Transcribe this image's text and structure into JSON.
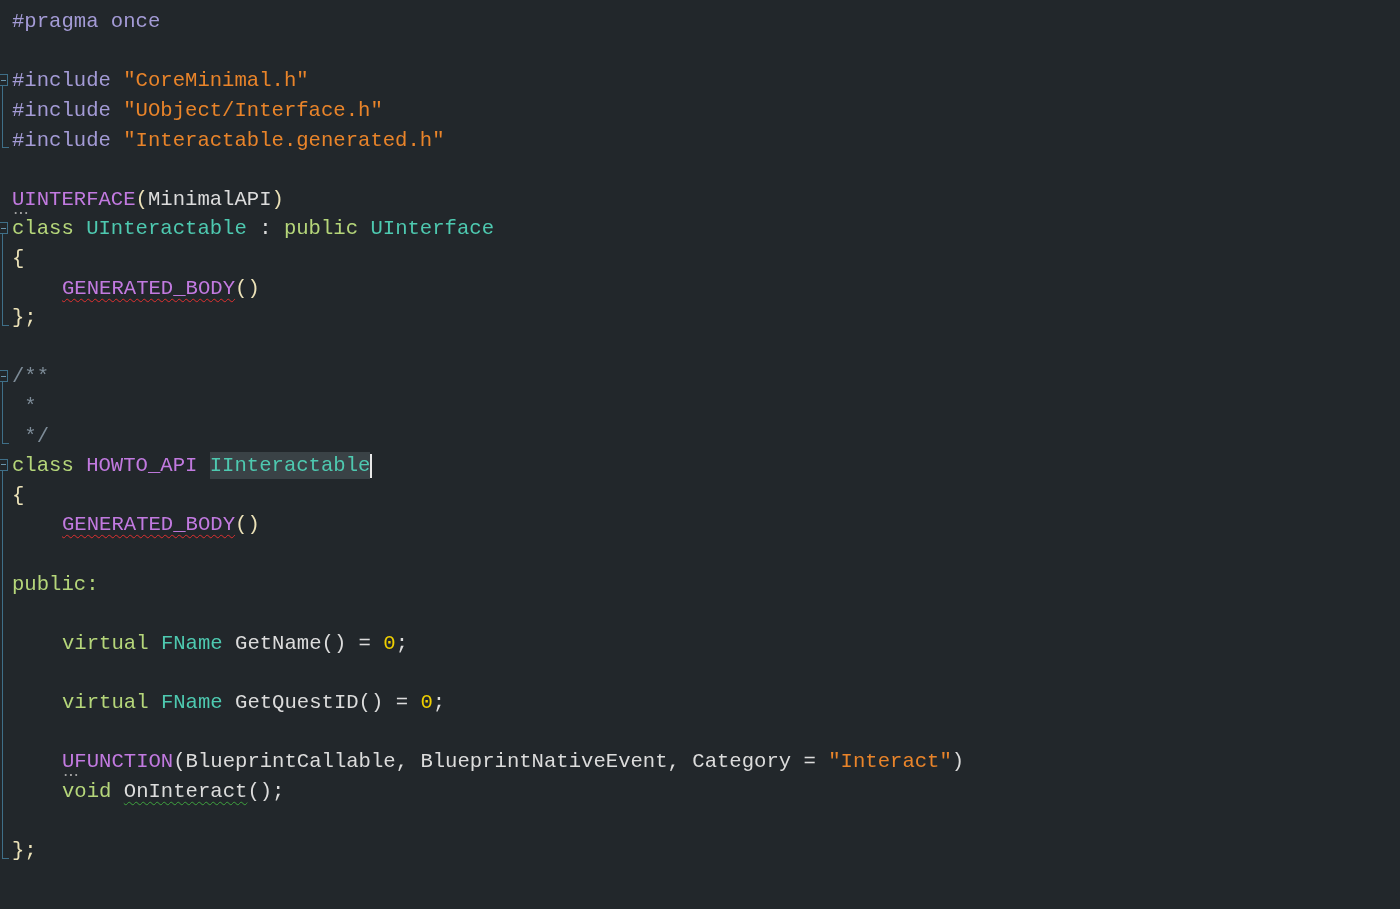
{
  "editor": {
    "lines": [
      {
        "tokens": [
          {
            "kind": "preproc",
            "text": "#pragma once"
          }
        ]
      },
      {
        "in_fold": false
      },
      {
        "fold_start": true,
        "tokens": [
          {
            "kind": "preproc",
            "text": "#include "
          },
          {
            "kind": "string",
            "text": "\"CoreMinimal.h\""
          }
        ]
      },
      {
        "in_fold": true,
        "tokens": [
          {
            "kind": "preproc",
            "text": "#include "
          },
          {
            "kind": "string",
            "text": "\"UObject/Interface.h\""
          }
        ]
      },
      {
        "fold_end": true,
        "tokens": [
          {
            "kind": "preproc",
            "text": "#include "
          },
          {
            "kind": "string",
            "text": "\"Interactable.generated.h\""
          }
        ]
      },
      {
        "in_fold": false
      },
      {
        "tokens": [
          {
            "kind": "macro",
            "text": "UINTERFACE",
            "hint": true
          },
          {
            "kind": "punct",
            "text": "("
          },
          {
            "kind": "plain",
            "text": "MinimalAPI"
          },
          {
            "kind": "punct",
            "text": ")"
          }
        ]
      },
      {
        "fold_start": true,
        "tokens": [
          {
            "kind": "keyword",
            "text": "class "
          },
          {
            "kind": "type",
            "text": "UInteractable"
          },
          {
            "kind": "plain",
            "text": " : "
          },
          {
            "kind": "keyword",
            "text": "public "
          },
          {
            "kind": "type",
            "text": "UInterface"
          }
        ]
      },
      {
        "in_fold": true,
        "tokens": [
          {
            "kind": "punct",
            "text": "{"
          }
        ]
      },
      {
        "in_fold": true,
        "indent": true,
        "tokens": [
          {
            "kind": "macro",
            "text": "GENERATED_BODY",
            "error": true
          },
          {
            "kind": "punct",
            "text": "()"
          }
        ]
      },
      {
        "fold_end": true,
        "tokens": [
          {
            "kind": "punct",
            "text": "};"
          }
        ]
      },
      {
        "in_fold": false
      },
      {
        "fold_start": true,
        "tokens": [
          {
            "kind": "comment",
            "text": "/**"
          }
        ]
      },
      {
        "in_fold": true,
        "tokens": [
          {
            "kind": "comment",
            "text": " *"
          }
        ]
      },
      {
        "fold_end": true,
        "tokens": [
          {
            "kind": "comment",
            "text": " */"
          }
        ]
      },
      {
        "fold_start": true,
        "tokens": [
          {
            "kind": "keyword",
            "text": "class "
          },
          {
            "kind": "macro",
            "text": "HOWTO_API "
          },
          {
            "kind": "type",
            "text": "IInteractable",
            "highlighted": true,
            "caret": true
          }
        ]
      },
      {
        "in_fold": true,
        "tokens": [
          {
            "kind": "punct",
            "text": "{"
          }
        ]
      },
      {
        "in_fold": true,
        "indent": true,
        "tokens": [
          {
            "kind": "macro",
            "text": "GENERATED_BODY",
            "error": true
          },
          {
            "kind": "punct",
            "text": "()"
          }
        ]
      },
      {
        "in_fold": true
      },
      {
        "in_fold": true,
        "tokens": [
          {
            "kind": "keyword",
            "text": "public:"
          }
        ]
      },
      {
        "in_fold": true
      },
      {
        "in_fold": true,
        "indent": true,
        "tokens": [
          {
            "kind": "keyword",
            "text": "virtual "
          },
          {
            "kind": "type",
            "text": "FName"
          },
          {
            "kind": "plain",
            "text": " GetName() = "
          },
          {
            "kind": "number",
            "text": "0"
          },
          {
            "kind": "plain",
            "text": ";"
          }
        ]
      },
      {
        "in_fold": true
      },
      {
        "in_fold": true,
        "indent": true,
        "tokens": [
          {
            "kind": "keyword",
            "text": "virtual "
          },
          {
            "kind": "type",
            "text": "FName"
          },
          {
            "kind": "plain",
            "text": " GetQuestID() = "
          },
          {
            "kind": "number",
            "text": "0"
          },
          {
            "kind": "plain",
            "text": ";"
          }
        ]
      },
      {
        "in_fold": true
      },
      {
        "in_fold": true,
        "indent": true,
        "tokens": [
          {
            "kind": "macro",
            "text": "UFUNCTION",
            "hint": true
          },
          {
            "kind": "plain",
            "text": "(BlueprintCallable, BlueprintNativeEvent, Category = "
          },
          {
            "kind": "string",
            "text": "\"Interact\""
          },
          {
            "kind": "plain",
            "text": ")"
          }
        ]
      },
      {
        "in_fold": true,
        "indent": true,
        "tokens": [
          {
            "kind": "keyword",
            "text": "void "
          },
          {
            "kind": "plain",
            "text": "OnInteract",
            "warning": true
          },
          {
            "kind": "plain",
            "text": "();"
          }
        ]
      },
      {
        "in_fold": true
      },
      {
        "fold_end": true,
        "tokens": [
          {
            "kind": "punct",
            "text": "};"
          }
        ]
      }
    ]
  }
}
